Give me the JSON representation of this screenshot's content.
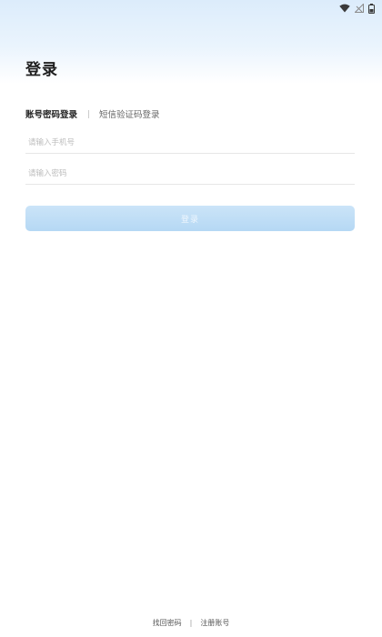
{
  "status_bar": {
    "icons": [
      "wifi-icon",
      "signal-icon",
      "battery-icon"
    ]
  },
  "header": {
    "title": "登录"
  },
  "tabs": [
    {
      "label": "账号密码登录",
      "active": true
    },
    {
      "label": "短信验证码登录",
      "active": false
    }
  ],
  "form": {
    "phone_placeholder": "请输入手机号",
    "phone_value": "",
    "password_placeholder": "请输入密码",
    "password_value": "",
    "submit_label": "登录"
  },
  "footer": {
    "forgot_password": "找回密码",
    "separator": "|",
    "register": "注册账号"
  },
  "colors": {
    "header_gradient_top": "#dcecfb",
    "button_bg": "#b5d8f4",
    "button_text": "#eef6fd",
    "divider": "#e6e6e6"
  }
}
